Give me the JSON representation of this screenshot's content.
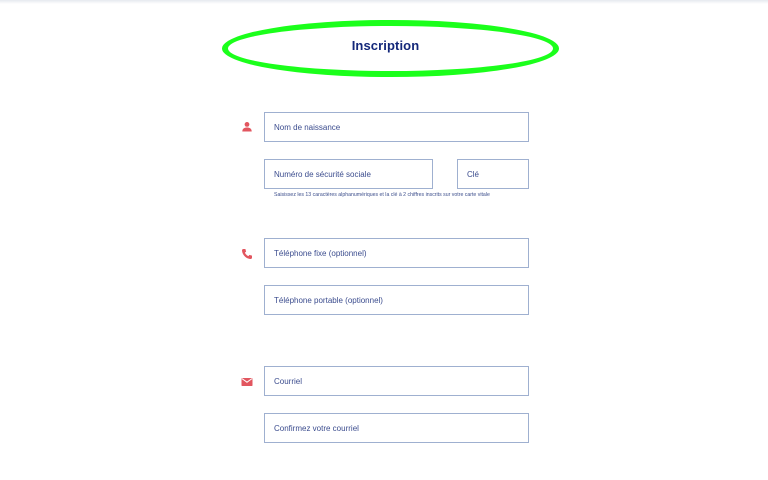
{
  "header": {
    "title": "Inscription"
  },
  "identity": {
    "icon": "person-icon",
    "birth_name": {
      "placeholder": "Nom de naissance",
      "value": ""
    },
    "ssn": {
      "placeholder": "Numéro de sécurité sociale",
      "value": ""
    },
    "key": {
      "placeholder": "Clé",
      "value": ""
    },
    "helper_text": "Saisissez les 13 caractères alphanumériques et la clé à 2 chiffres inscrits sur votre carte vitale"
  },
  "phone": {
    "icon": "phone-icon",
    "landline": {
      "placeholder": "Téléphone fixe (optionnel)",
      "value": ""
    },
    "mobile": {
      "placeholder": "Téléphone portable (optionnel)",
      "value": ""
    }
  },
  "email": {
    "icon": "mail-icon",
    "email": {
      "placeholder": "Courriel",
      "value": ""
    },
    "confirm": {
      "placeholder": "Confirmez votre courriel",
      "value": ""
    }
  },
  "colors": {
    "title": "#14287a",
    "icon": "#e2565f",
    "field_border": "#9fb0d0",
    "highlight": "#1bff1b"
  }
}
